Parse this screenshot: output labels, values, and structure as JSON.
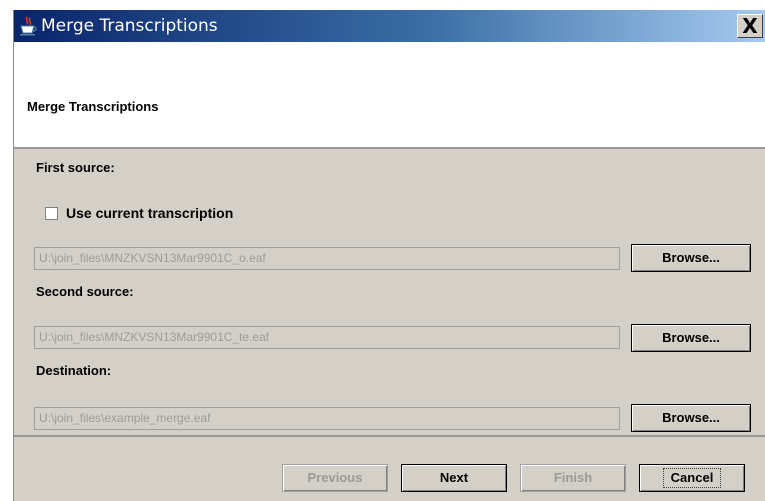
{
  "window": {
    "title": "Merge Transcriptions",
    "close_label": "X"
  },
  "header": {
    "title": "Merge Transcriptions"
  },
  "form": {
    "first_source_label": "First source:",
    "use_current_label": "Use current transcription",
    "use_current_checked": false,
    "first_source_value": "U:\\join_files\\MNZKVSN13Mar9901C_o.eaf",
    "second_source_label": "Second source:",
    "second_source_value": "U:\\join_files\\MNZKVSN13Mar9901C_te.eaf",
    "destination_label": "Destination:",
    "destination_value": "U:\\join_files\\example_merge.eaf",
    "browse_label": "Browse..."
  },
  "footer": {
    "previous_label": "Previous",
    "next_label": "Next",
    "finish_label": "Finish",
    "cancel_label": "Cancel"
  },
  "icons": {
    "title_icon": "java-cup-icon",
    "close_icon": "close-icon"
  }
}
